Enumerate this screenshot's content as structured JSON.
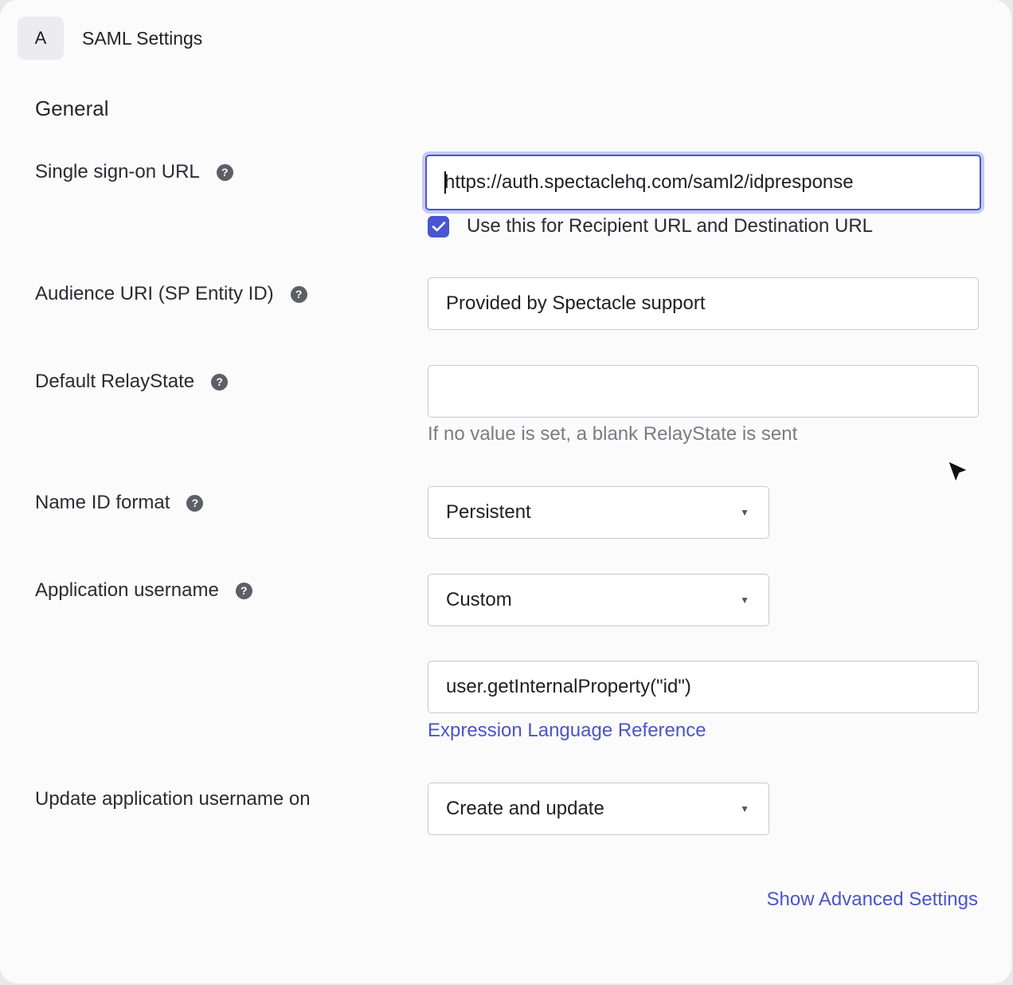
{
  "header": {
    "step": "A",
    "title": "SAML Settings"
  },
  "section": {
    "title": "General"
  },
  "fields": {
    "sso_url": {
      "label": "Single sign-on URL",
      "value": "https://auth.spectaclehq.com/saml2/idpresponse",
      "checkbox_label": "Use this for Recipient URL and Destination URL",
      "checkbox_checked": true
    },
    "audience_uri": {
      "label": "Audience URI (SP Entity ID)",
      "value": "Provided by Spectacle support"
    },
    "relay_state": {
      "label": "Default RelayState",
      "value": "",
      "hint": "If no value is set, a blank RelayState is sent"
    },
    "name_id_format": {
      "label": "Name ID format",
      "selected": "Persistent"
    },
    "app_username": {
      "label": "Application username",
      "selected": "Custom",
      "expression": "user.getInternalProperty(\"id\")",
      "reference_link": "Expression Language Reference"
    },
    "update_username_on": {
      "label": "Update application username on",
      "selected": "Create and update"
    }
  },
  "footer": {
    "advanced_link": "Show Advanced Settings"
  },
  "icons": {
    "help": "question-circle-icon",
    "dropdown": "triangle-down-icon",
    "check": "checkmark-icon",
    "cursor": "mouse-pointer-icon"
  },
  "colors": {
    "accent": "#4b55c8",
    "checkbox": "#4a55d1",
    "focus_ring": "#c6cbf3"
  }
}
